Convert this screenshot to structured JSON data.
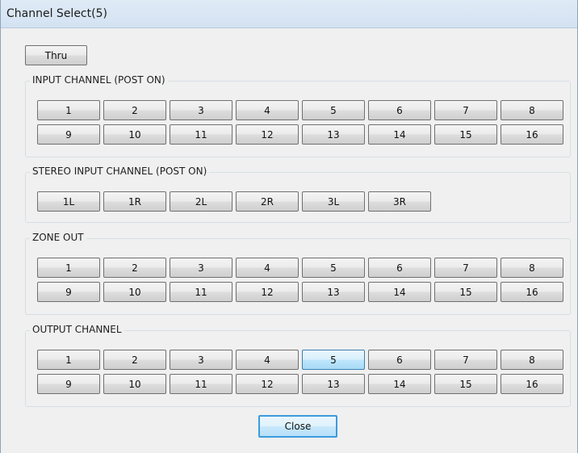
{
  "window": {
    "title": "Channel Select(5)"
  },
  "thru_button": {
    "label": "Thru"
  },
  "groups": [
    {
      "label": "INPUT CHANNEL (POST ON)",
      "rows": [
        [
          "1",
          "2",
          "3",
          "4",
          "5",
          "6",
          "7",
          "8"
        ],
        [
          "9",
          "10",
          "11",
          "12",
          "13",
          "14",
          "15",
          "16"
        ]
      ]
    },
    {
      "label": "STEREO INPUT CHANNEL (POST ON)",
      "rows": [
        [
          "1L",
          "1R",
          "2L",
          "2R",
          "3L",
          "3R"
        ]
      ]
    },
    {
      "label": "ZONE OUT",
      "rows": [
        [
          "1",
          "2",
          "3",
          "4",
          "5",
          "6",
          "7",
          "8"
        ],
        [
          "9",
          "10",
          "11",
          "12",
          "13",
          "14",
          "15",
          "16"
        ]
      ]
    },
    {
      "label": "OUTPUT CHANNEL",
      "selected": "5",
      "rows": [
        [
          "1",
          "2",
          "3",
          "4",
          "5",
          "6",
          "7",
          "8"
        ],
        [
          "9",
          "10",
          "11",
          "12",
          "13",
          "14",
          "15",
          "16"
        ]
      ]
    }
  ],
  "close_button": {
    "label": "Close"
  }
}
